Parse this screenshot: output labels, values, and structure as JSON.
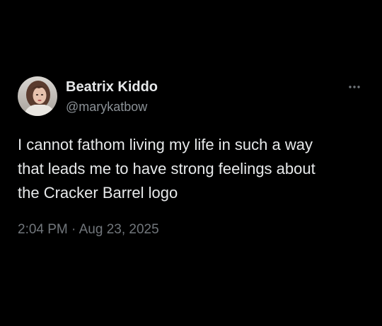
{
  "tweet": {
    "author": {
      "display_name": "Beatrix Kiddo",
      "handle": "@marykatbow"
    },
    "text_lines": [
      "I cannot fathom living my life in such a way",
      "that leads me to have strong feelings about",
      "the Cracker Barrel logo"
    ],
    "time": "2:04 PM",
    "separator": "·",
    "date": "Aug 23, 2025"
  },
  "icons": {
    "more": "more-horizontal-icon",
    "avatar": "profile-photo"
  },
  "colors": {
    "background": "#000000",
    "primary_text": "#e7e9ea",
    "secondary_text": "#71767b"
  }
}
